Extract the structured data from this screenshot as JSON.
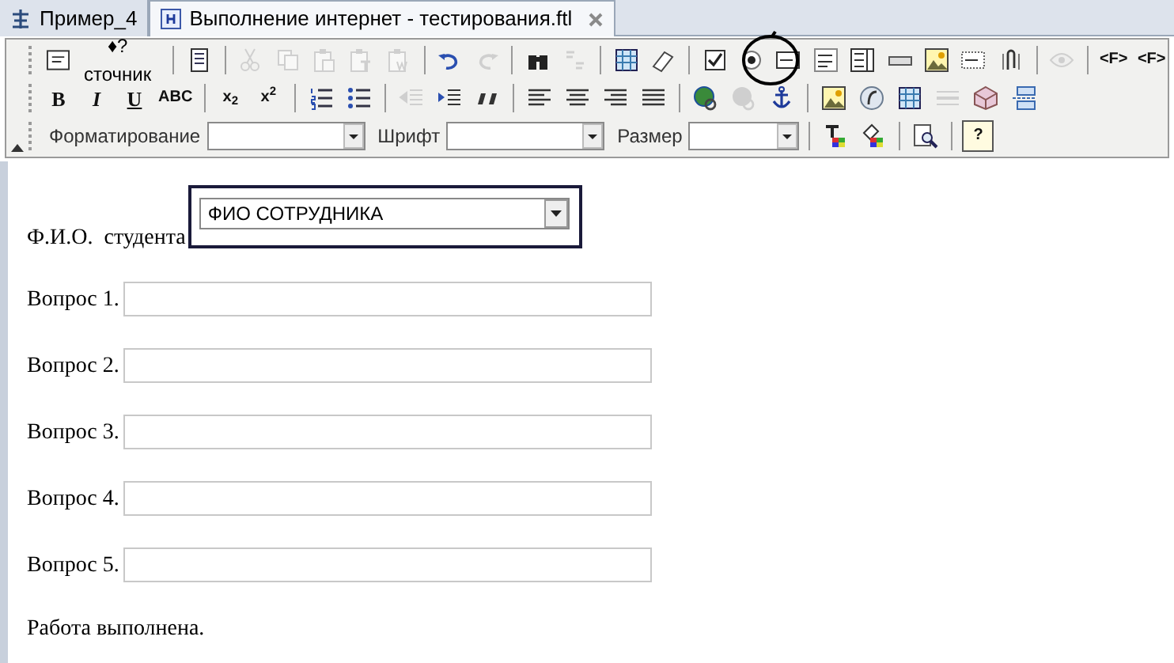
{
  "tabs": [
    {
      "label": "Пример_4",
      "selected": false
    },
    {
      "label": "Выполнение интернет - тестирования.ftl",
      "selected": true
    }
  ],
  "toolbars": [
    [
      {
        "kind": "button",
        "text": "♦?сточник"
      },
      {
        "kind": "sep"
      },
      {
        "kind": "icon",
        "disabled": false
      },
      {
        "kind": "sep"
      },
      {
        "kind": "icon",
        "disabled": true
      },
      {
        "kind": "icon",
        "disabled": true
      },
      {
        "kind": "icon",
        "disabled": true
      },
      {
        "kind": "icon",
        "disabled": true
      },
      {
        "kind": "icon",
        "disabled": true
      },
      {
        "kind": "sep"
      },
      {
        "kind": "icon",
        "disabled": false
      },
      {
        "kind": "icon",
        "disabled": true
      },
      {
        "kind": "sep"
      },
      {
        "kind": "icon",
        "disabled": false
      },
      {
        "kind": "icon",
        "disabled": true
      },
      {
        "kind": "sep"
      },
      {
        "kind": "icon",
        "disabled": false
      },
      {
        "kind": "icon",
        "disabled": false
      },
      {
        "kind": "sep"
      },
      {
        "kind": "icon",
        "disabled": false
      },
      {
        "kind": "icon",
        "disabled": false
      },
      {
        "kind": "icon",
        "disabled": false
      },
      {
        "kind": "icon",
        "disabled": false
      },
      {
        "kind": "icon",
        "disabled": false
      },
      {
        "kind": "icon",
        "disabled": false
      },
      {
        "kind": "icon",
        "disabled": false
      },
      {
        "kind": "icon",
        "disabled": false
      },
      {
        "kind": "icon",
        "disabled": false
      },
      {
        "kind": "sep"
      },
      {
        "kind": "icon",
        "disabled": true
      },
      {
        "kind": "sep"
      },
      {
        "kind": "glyph",
        "text": "<F>",
        "disabled": false
      },
      {
        "kind": "glyph",
        "text": "<F>",
        "disabled": false
      }
    ],
    [
      {
        "kind": "glyph",
        "text": "B",
        "disabled": false
      },
      {
        "kind": "glyph",
        "text": "I",
        "disabled": false
      },
      {
        "kind": "glyph",
        "text": "U",
        "disabled": false
      },
      {
        "kind": "glyph",
        "text": "ABC",
        "disabled": false
      },
      {
        "kind": "sep"
      },
      {
        "kind": "glyph",
        "text": "x$_{2}$",
        "disabled": false
      },
      {
        "kind": "glyph",
        "text": "x$^{2}$",
        "disabled": false
      },
      {
        "kind": "sep"
      },
      {
        "kind": "icon",
        "disabled": false
      },
      {
        "kind": "icon",
        "disabled": false
      },
      {
        "kind": "sep"
      },
      {
        "kind": "icon",
        "disabled": true
      },
      {
        "kind": "icon",
        "disabled": false
      },
      {
        "kind": "icon",
        "disabled": false
      },
      {
        "kind": "sep"
      },
      {
        "kind": "icon",
        "disabled": false
      },
      {
        "kind": "icon",
        "disabled": false
      },
      {
        "kind": "icon",
        "disabled": false
      },
      {
        "kind": "icon",
        "disabled": false
      },
      {
        "kind": "sep"
      },
      {
        "kind": "icon",
        "disabled": false
      },
      {
        "kind": "icon",
        "disabled": true
      },
      {
        "kind": "icon",
        "disabled": false
      },
      {
        "kind": "sep"
      },
      {
        "kind": "icon",
        "disabled": false
      },
      {
        "kind": "icon",
        "disabled": false
      },
      {
        "kind": "icon",
        "disabled": false
      },
      {
        "kind": "icon",
        "disabled": true
      },
      {
        "kind": "icon",
        "disabled": false
      },
      {
        "kind": "icon",
        "disabled": false
      }
    ],
    [
      {
        "kind": "label",
        "text": "Форматирование"
      },
      {
        "kind": "select"
      },
      {
        "kind": "label",
        "text": "Шрифт"
      },
      {
        "kind": "select"
      },
      {
        "kind": "label",
        "text": "Размер"
      },
      {
        "kind": "select"
      },
      {
        "kind": "sep"
      },
      {
        "kind": "icon",
        "disabled": false
      },
      {
        "kind": "icon",
        "disabled": false
      },
      {
        "kind": "sep"
      },
      {
        "kind": "icon",
        "disabled": false
      },
      {
        "kind": "sep"
      },
      {
        "kind": "glyph",
        "text": "?",
        "disabled": false
      }
    ]
  ],
  "form": {
    "student": {
      "label": "Ф.И.О.  студента",
      "value": "ФИО СОТРУДНИКА"
    },
    "questions": [
      {
        "label": "Вопрос 1."
      },
      {
        "label": "Вопрос 2."
      },
      {
        "label": "Вопрос 3."
      },
      {
        "label": "Вопрос 4."
      },
      {
        "label": "Вопрос 5."
      }
    ],
    "footer": "Работа выполнена."
  }
}
